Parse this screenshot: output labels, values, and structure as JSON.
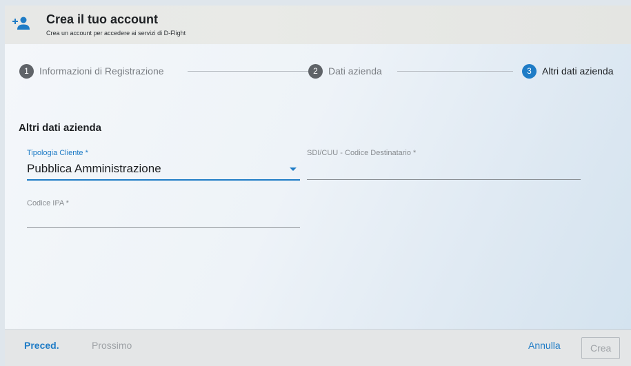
{
  "header": {
    "title": "Crea il tuo account",
    "subtitle": "Crea un account per accedere ai servizi di D-Flight",
    "icon": "add-user-icon"
  },
  "stepper": {
    "steps": [
      {
        "number": "1",
        "label": "Informazioni di Registrazione",
        "state": "inactive"
      },
      {
        "number": "2",
        "label": "Dati azienda",
        "state": "inactive"
      },
      {
        "number": "3",
        "label": "Altri dati azienda",
        "state": "active"
      }
    ]
  },
  "form": {
    "section_title": "Altri dati azienda",
    "tipologia": {
      "label": "Tipologia Cliente *",
      "value": "Pubblica Amministrazione"
    },
    "sdi": {
      "label": "SDI/CUU - Codice Destinatario *",
      "value": ""
    },
    "ipa": {
      "label": "Codice IPA *",
      "value": ""
    }
  },
  "footer": {
    "prev_label": "Preced.",
    "next_label": "Prossimo",
    "cancel_label": "Annulla",
    "create_label": "Crea"
  },
  "colors": {
    "accent": "#1f7cc6",
    "step_inactive": "#5f6368",
    "text": "#1d2023"
  }
}
